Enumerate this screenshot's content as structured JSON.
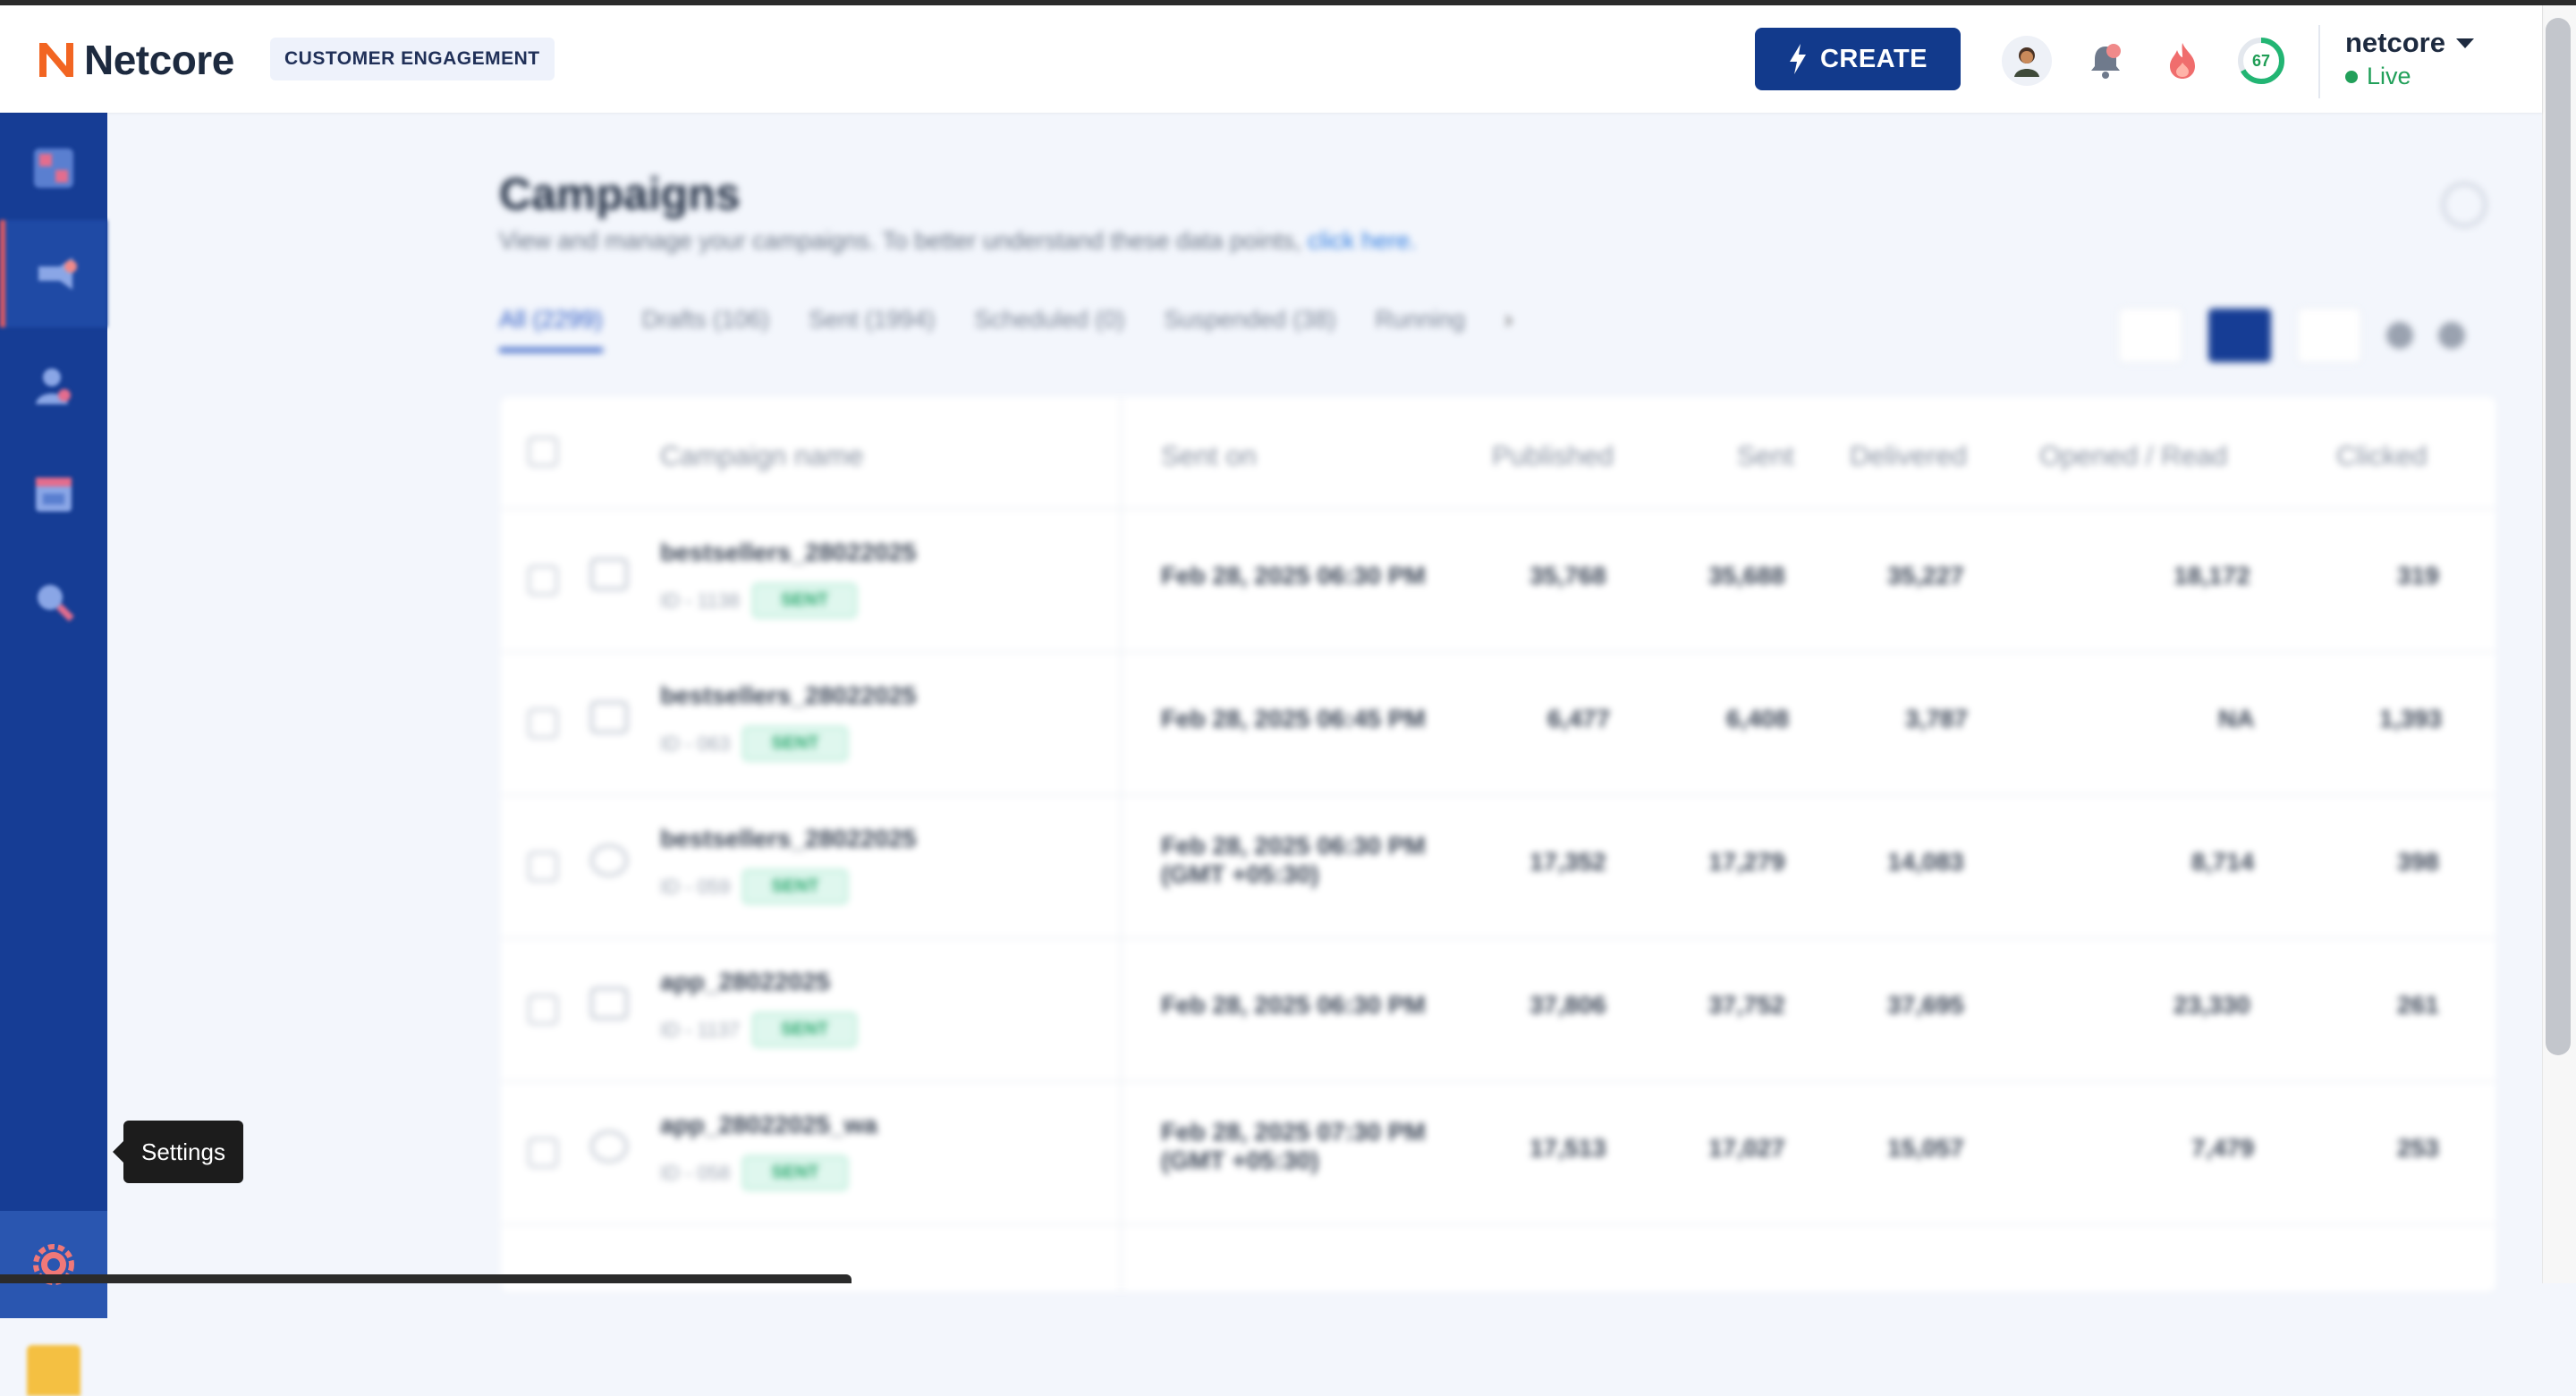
{
  "header": {
    "logo_text": "Netcore",
    "product_label": "CUSTOMER ENGAGEMENT",
    "create_label": "CREATE",
    "score_value": "67",
    "account_name": "netcore",
    "account_status": "Live"
  },
  "tooltip": {
    "label": "Settings"
  },
  "colors": {
    "primary": "#163d95",
    "create_button": "#123a8c",
    "live_green": "#22a05a",
    "accent_orange": "#f26522"
  },
  "icons": {
    "sidebar": [
      "dashboard-icon",
      "campaigns-icon",
      "customers-icon",
      "calendar-icon",
      "analytics-icon",
      "settings-icon"
    ],
    "header": [
      "lightning-icon",
      "avatar-icon",
      "bell-icon",
      "flame-icon",
      "score-ring-icon",
      "caret-down-icon"
    ]
  },
  "page": {
    "title": "Campaigns",
    "subtitle": "View and manage your campaigns. To better understand these data points,",
    "subtitle_link": "click here.",
    "tabs": [
      "All (2299)",
      "Drafts (106)",
      "Sent (1994)",
      "Scheduled (0)",
      "Suspended (38)",
      "Running"
    ]
  },
  "table": {
    "columns": [
      "Campaign name",
      "Sent on",
      "Published",
      "Sent",
      "Delivered",
      "Opened / Read",
      "Clicked"
    ],
    "rows": [
      {
        "name": "bestsellers_28022025",
        "meta": "ID - 1138",
        "status": "SENT",
        "sent_on": "Feb 28, 2025 06:30 PM",
        "published": "35,768",
        "sent": "35,688",
        "delivered": "35,227",
        "opened": "18,172",
        "clicked": "319"
      },
      {
        "name": "bestsellers_28022025",
        "meta": "ID - 063",
        "status": "SENT",
        "sent_on": "Feb 28, 2025 06:45 PM",
        "published": "6,477",
        "sent": "6,408",
        "delivered": "3,787",
        "opened": "NA",
        "clicked": "1,393"
      },
      {
        "name": "bestsellers_28022025",
        "meta": "ID - 059",
        "status": "SENT",
        "sent_on": "Feb 28, 2025 06:30 PM (GMT +05:30)",
        "published": "17,352",
        "sent": "17,279",
        "delivered": "14,083",
        "opened": "8,714",
        "clicked": "398"
      },
      {
        "name": "app_28022025",
        "meta": "ID - 1137",
        "status": "SENT",
        "sent_on": "Feb 28, 2025 06:30 PM",
        "published": "37,806",
        "sent": "37,752",
        "delivered": "37,695",
        "opened": "23,330",
        "clicked": "261"
      },
      {
        "name": "app_28022025_wa",
        "meta": "ID - 058",
        "status": "SENT",
        "sent_on": "Feb 28, 2025 07:30 PM (GMT +05:30)",
        "published": "17,513",
        "sent": "17,027",
        "delivered": "15,057",
        "opened": "7,479",
        "clicked": "253"
      }
    ]
  }
}
